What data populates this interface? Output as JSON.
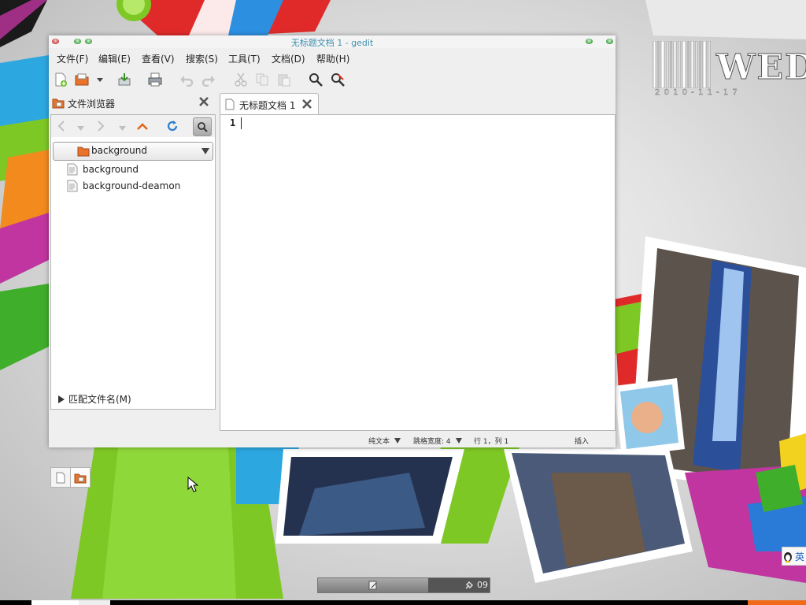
{
  "window": {
    "title": "无标题文档 1 - gedit"
  },
  "menubar": {
    "items": [
      "文件(F)",
      "编辑(E)",
      "查看(V)",
      "搜索(S)",
      "工具(T)",
      "文档(D)",
      "帮助(H)"
    ]
  },
  "toolbar": {
    "buttons": [
      "new-document-icon",
      "open-icon",
      "open-recent-dropdown-icon",
      "save-icon",
      "print-icon",
      "undo-icon",
      "redo-icon",
      "cut-icon",
      "copy-icon",
      "paste-icon",
      "find-icon",
      "find-replace-icon"
    ]
  },
  "side_panel": {
    "title": "文件浏览器",
    "current_folder": "background",
    "files": [
      {
        "name": "background"
      },
      {
        "name": "background-deamon"
      }
    ],
    "match_filename_label": "匹配文件名(M)"
  },
  "editor": {
    "tab_label": "无标题文档 1",
    "line_number": "1",
    "content": ""
  },
  "statusbar": {
    "syntax": "纯文本",
    "tab_width_label": "跳格宽度: 4",
    "cursor_position": "行 1，列 1",
    "insert_mode": "插入"
  },
  "desktop": {
    "logo_text": "WED",
    "date_text": "2 0 1 0 - 1 1 - 1 7",
    "taskbar_time": "09",
    "ime_label": "英"
  },
  "colors": {
    "title_text": "#3f8fb0",
    "window_bg": "#efefef",
    "folder_orange": "#e8732b",
    "wallpaper_green": "#7ec825",
    "wallpaper_red": "#e02a2a"
  }
}
